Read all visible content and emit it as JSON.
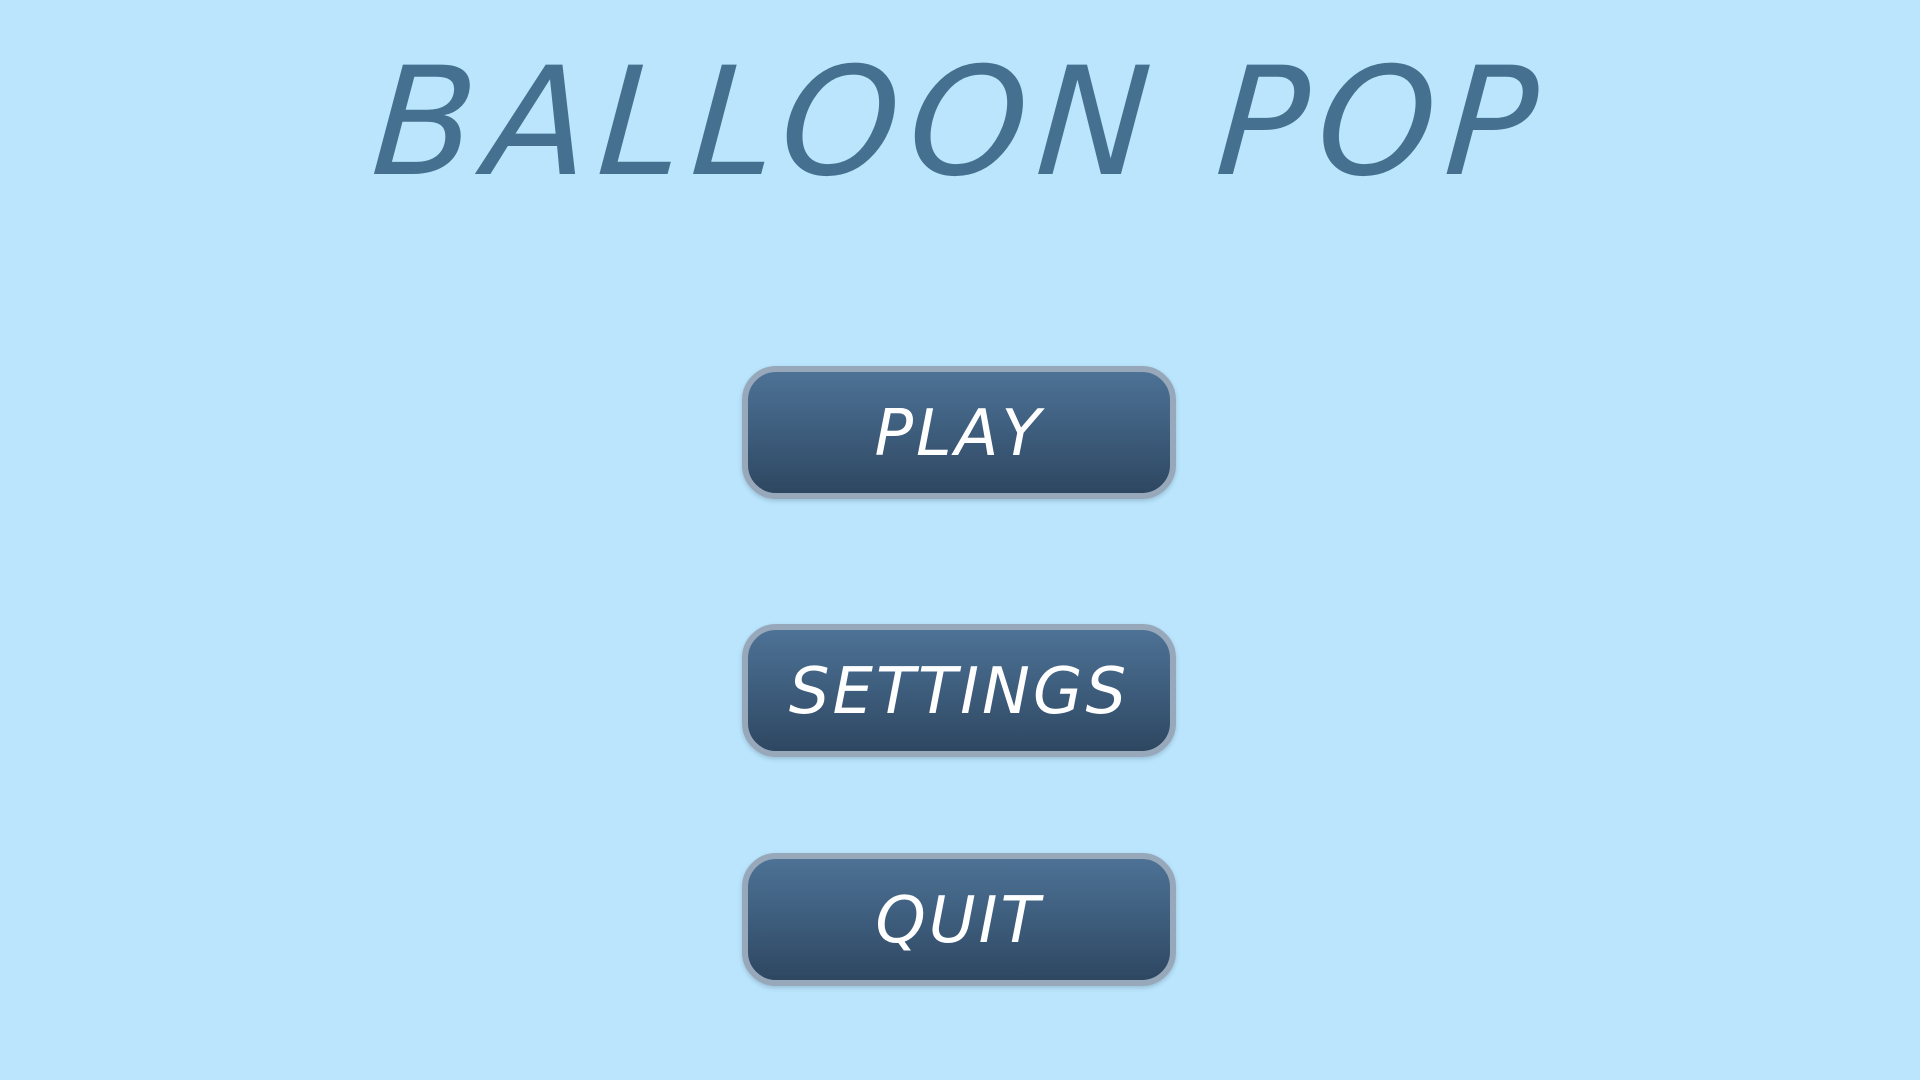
{
  "game": {
    "title": "BALLOON POP"
  },
  "menu": {
    "play_label": "PLAY",
    "settings_label": "SETTINGS",
    "quit_label": "QUIT"
  },
  "colors": {
    "background": "#bae5fd",
    "title": "#46708f",
    "button_fill": "#3f5f7f",
    "button_border": "#97a8ba",
    "button_text": "#ffffff"
  }
}
